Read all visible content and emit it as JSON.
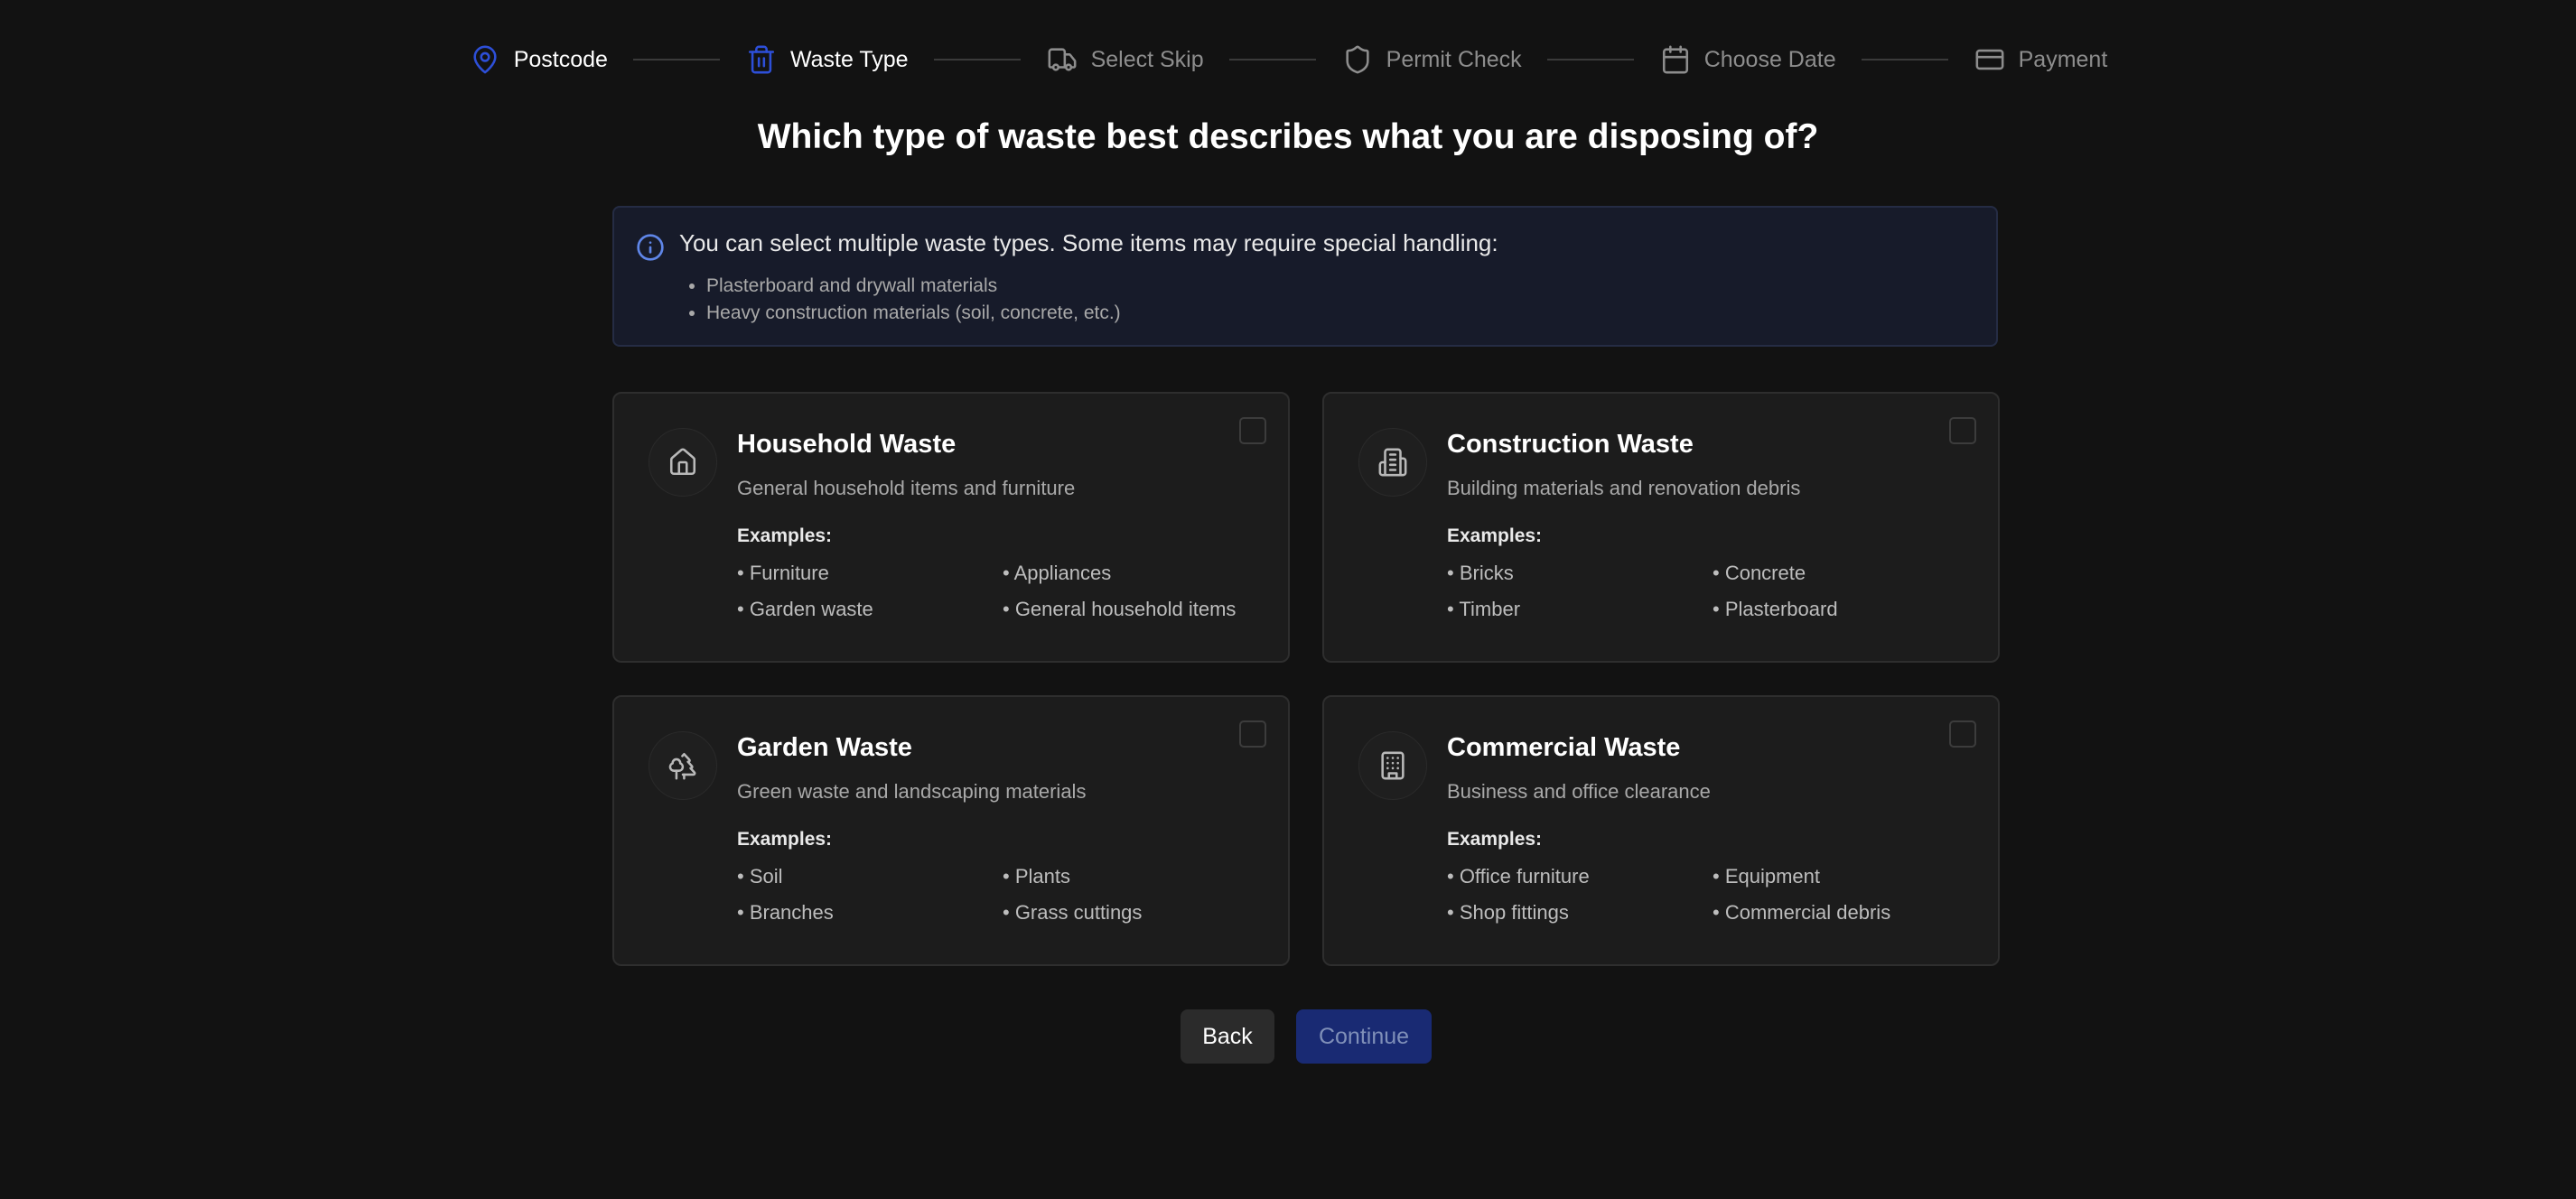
{
  "stepper": [
    {
      "label": "Postcode",
      "icon": "map-pin-icon",
      "state": "done"
    },
    {
      "label": "Waste Type",
      "icon": "trash-icon",
      "state": "current"
    },
    {
      "label": "Select Skip",
      "icon": "truck-icon",
      "state": "todo"
    },
    {
      "label": "Permit Check",
      "icon": "shield-icon",
      "state": "todo"
    },
    {
      "label": "Choose Date",
      "icon": "calendar-icon",
      "state": "todo"
    },
    {
      "label": "Payment",
      "icon": "credit-card-icon",
      "state": "todo"
    }
  ],
  "heading": "Which type of waste best describes what you are disposing of?",
  "info": {
    "text": "You can select multiple waste types. Some items may require special handling:",
    "items": [
      "Plasterboard and drywall materials",
      "Heavy construction materials (soil, concrete, etc.)"
    ]
  },
  "cards": [
    {
      "title": "Household Waste",
      "description": "General household items and furniture",
      "examples_label": "Examples:",
      "examples": [
        "• Furniture",
        "• Appliances",
        "• Garden waste",
        "• General household items"
      ],
      "icon": "home-icon",
      "selected": false
    },
    {
      "title": "Construction Waste",
      "description": "Building materials and renovation debris",
      "examples_label": "Examples:",
      "examples": [
        "• Bricks",
        "• Concrete",
        "• Timber",
        "• Plasterboard"
      ],
      "icon": "building-icon",
      "selected": false
    },
    {
      "title": "Garden Waste",
      "description": "Green waste and landscaping materials",
      "examples_label": "Examples:",
      "examples": [
        "• Soil",
        "• Plants",
        "• Branches",
        "• Grass cuttings"
      ],
      "icon": "trees-icon",
      "selected": false
    },
    {
      "title": "Commercial Waste",
      "description": "Business and office clearance",
      "examples_label": "Examples:",
      "examples": [
        "• Office furniture",
        "• Equipment",
        "• Shop fittings",
        "• Commercial debris"
      ],
      "icon": "office-building-icon",
      "selected": false
    }
  ],
  "buttons": {
    "back": "Back",
    "continue": "Continue"
  },
  "colors": {
    "background": "#121212",
    "accent": "#2d4fd8",
    "continue_disabled_bg": "#192a73",
    "info_bg": "#171b2a",
    "card_bg": "#1c1c1c"
  }
}
